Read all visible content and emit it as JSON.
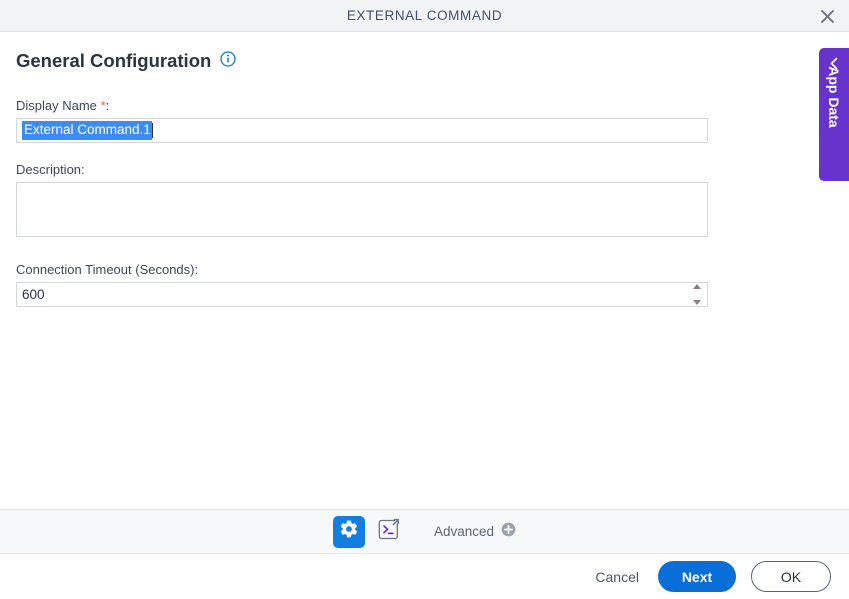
{
  "window": {
    "title": "EXTERNAL COMMAND",
    "close_icon": "close-icon"
  },
  "heading": {
    "text": "General Configuration",
    "info_icon": "info-circle-icon"
  },
  "form": {
    "display_name": {
      "label": "Display Name ",
      "required_mark": "*",
      "label_suffix": ":",
      "value": "External Command.1",
      "selected": true
    },
    "description": {
      "label": "Description:",
      "value": "",
      "placeholder": ""
    },
    "connection_timeout": {
      "label": "Connection Timeout (Seconds):",
      "value": "600"
    }
  },
  "side_tab": {
    "label": "App Data",
    "chevron_icon": "chevron-left-icon",
    "color": "#6633cc"
  },
  "toolbar": {
    "gear_icon": "gear-icon",
    "console_icon": "console-external-link-icon",
    "advanced_label": "Advanced",
    "advanced_add_icon": "plus-circle-icon"
  },
  "footer": {
    "cancel_label": "Cancel",
    "next_label": "Next",
    "ok_label": "OK",
    "accent_color": "#0a6ed8"
  }
}
